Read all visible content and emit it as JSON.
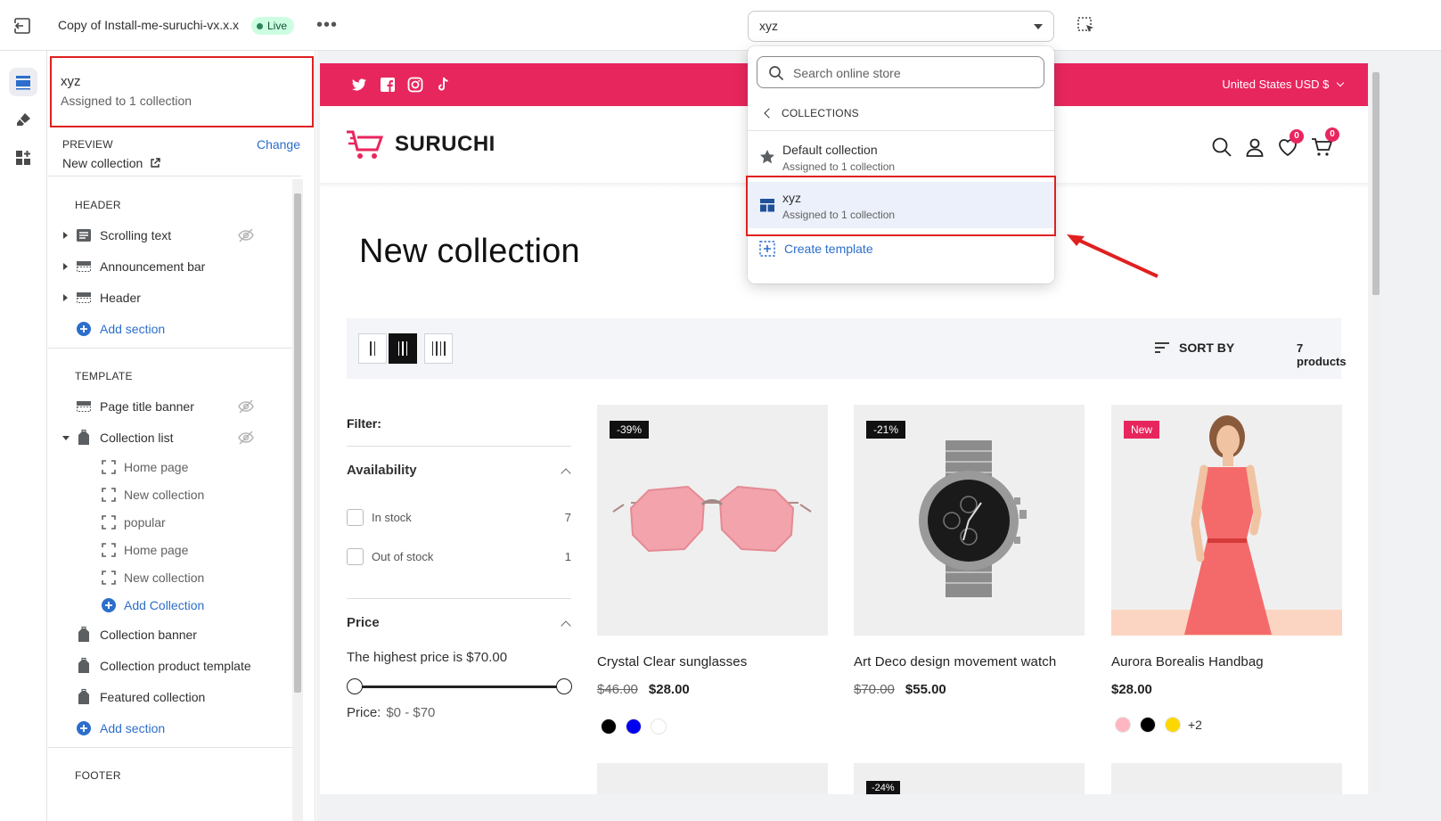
{
  "topbar": {
    "theme_name": "Copy of Install-me-suruchi-vx.x.x",
    "status": "Live",
    "template_select": "xyz"
  },
  "sidebar": {
    "selected_title": "xyz",
    "selected_sub": "Assigned to 1 collection",
    "preview_label": "PREVIEW",
    "preview_value": "New collection",
    "change_label": "Change",
    "header_group": "HEADER",
    "header_items": [
      "Scrolling text",
      "Announcement bar",
      "Header"
    ],
    "add_section": "Add section",
    "template_group": "TEMPLATE",
    "page_title_banner": "Page title banner",
    "collection_list": "Collection list",
    "collection_list_items": [
      "Home page",
      "New collection",
      "popular",
      "Home page",
      "New collection"
    ],
    "add_collection": "Add Collection",
    "template_items": [
      "Collection banner",
      "Collection product template",
      "Featured collection"
    ],
    "footer_group": "FOOTER"
  },
  "dropdown": {
    "search_placeholder": "Search online store",
    "back_label": "COLLECTIONS",
    "items": [
      {
        "title": "Default collection",
        "sub": "Assigned to 1 collection"
      },
      {
        "title": "xyz",
        "sub": "Assigned to 1 collection"
      }
    ],
    "create_label": "Create template"
  },
  "store": {
    "currency": "United States USD $",
    "logo": "SURUCHI",
    "wishlist_count": "0",
    "cart_count": "0",
    "page_title": "New collection",
    "sort_label": "SORT BY",
    "product_count": "7 products",
    "filter_label": "Filter:",
    "availability_label": "Availability",
    "in_stock": "In stock",
    "in_stock_count": "7",
    "out_stock": "Out of stock",
    "out_stock_count": "1",
    "price_label": "Price",
    "highest_price": "The highest price is $70.00",
    "price_range_label": "Price:",
    "price_range_value": "$0 - $70",
    "products": [
      {
        "badge": "-39%",
        "title": "Crystal Clear sunglasses",
        "old": "$46.00",
        "now": "$28.00",
        "swatches": [
          "#000000",
          "#0000ee",
          "#ffffff"
        ]
      },
      {
        "badge": "-21%",
        "title": "Art Deco design movement watch",
        "old": "$70.00",
        "now": "$55.00",
        "swatches": []
      },
      {
        "badge": "New",
        "title": "Aurora Borealis Handbag",
        "old": "",
        "now": "$28.00",
        "swatches": [
          "#ffb6c1",
          "#000000",
          "#ffd700"
        ],
        "more": "+2"
      }
    ],
    "next_badge": "-24%"
  },
  "colors": {
    "brand": "#e8265e",
    "highlight": "#e02020",
    "link": "#2c6ecb"
  }
}
